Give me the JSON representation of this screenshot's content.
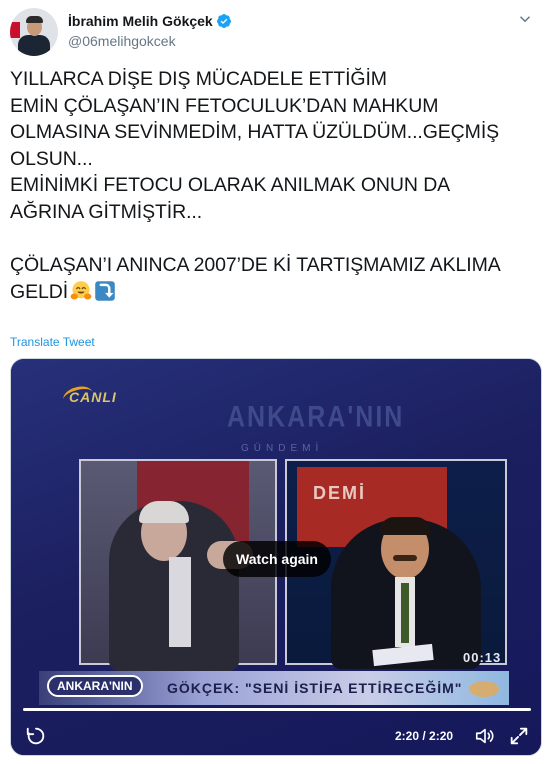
{
  "author": {
    "display_name": "İbrahim Melih Gökçek",
    "handle": "@06melihgokcek",
    "verified": true
  },
  "tweet": {
    "text": "YILLARCA DİŞE DIŞ MÜCADELE ETTİĞİM\nEMİN ÇÖLAŞAN’IN FETOCULUK’DAN MAHKUM\nOLMASINA SEVİNMEDİM, HATTA ÜZÜLDÜM...GEÇMİŞ\nOLSUN...\nEMİNİMKİ FETOCU OLARAK ANILMAK ONUN DA\nAĞRINA GİTMİŞTİR...\n\nÇÖLAŞAN’I ANINCA 2007’DE Kİ TARTIŞMAMIZ AKLIMA\nGELDİ",
    "emojis": [
      "hugging-face",
      "arrow-curving-down"
    ],
    "translate_label": "Translate Tweet"
  },
  "video": {
    "channel_logo": "CANLI",
    "show_title": "ANKARA'NIN",
    "show_subtitle": "GÜNDEMİ",
    "backdrop_text": "DEMİ",
    "timecode": "00:13",
    "lower_third_logo": "ANKARA'NIN",
    "caption": "GÖKÇEK: \"SENİ İSTİFA ETTİRECEĞİM\"",
    "watch_again_label": "Watch again",
    "time_display": "2:20 / 2:20",
    "progress": 1.0
  },
  "colors": {
    "link": "#1b95e0",
    "verified": "#1da1f2",
    "secondary_text": "#657786"
  }
}
